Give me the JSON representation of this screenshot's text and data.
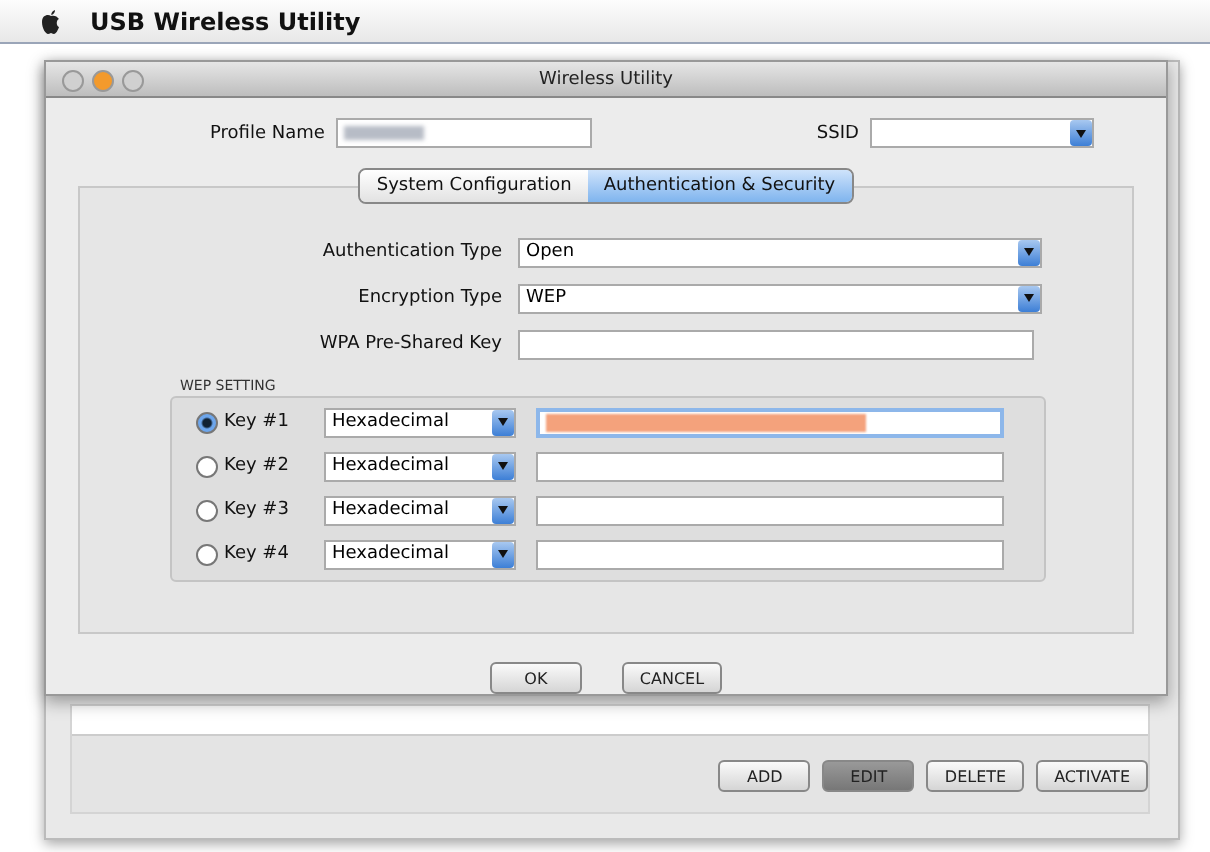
{
  "menu_bar": {
    "app_name": "USB Wireless Utility"
  },
  "main_window": {
    "buttons": [
      {
        "label": "ADD",
        "pressed": false
      },
      {
        "label": "EDIT",
        "pressed": true
      },
      {
        "label": "DELETE",
        "pressed": false
      },
      {
        "label": "ACTIVATE",
        "pressed": false
      }
    ]
  },
  "dialog": {
    "title": "Wireless Utility",
    "profile_name": {
      "label": "Profile Name"
    },
    "ssid": {
      "label": "SSID"
    },
    "tabs": [
      {
        "label": "System Configuration",
        "selected": false
      },
      {
        "label": "Authentication & Security",
        "selected": true
      }
    ],
    "fields": [
      {
        "kind": "select",
        "label": "Authentication Type",
        "value": "Open"
      },
      {
        "kind": "select",
        "label": "Encryption Type",
        "value": "WEP"
      },
      {
        "kind": "text",
        "label": "WPA Pre-Shared Key"
      }
    ],
    "wep_setting": {
      "title": "WEP SETTING",
      "keys": [
        {
          "label": "Key #1",
          "selected": true,
          "format": "Hexadecimal",
          "redacted": true
        },
        {
          "label": "Key #2",
          "selected": false,
          "format": "Hexadecimal",
          "redacted": false
        },
        {
          "label": "Key #3",
          "selected": false,
          "format": "Hexadecimal",
          "redacted": false
        },
        {
          "label": "Key #4",
          "selected": false,
          "format": "Hexadecimal",
          "redacted": false
        }
      ]
    },
    "buttons": [
      "OK",
      "CANCEL"
    ]
  }
}
